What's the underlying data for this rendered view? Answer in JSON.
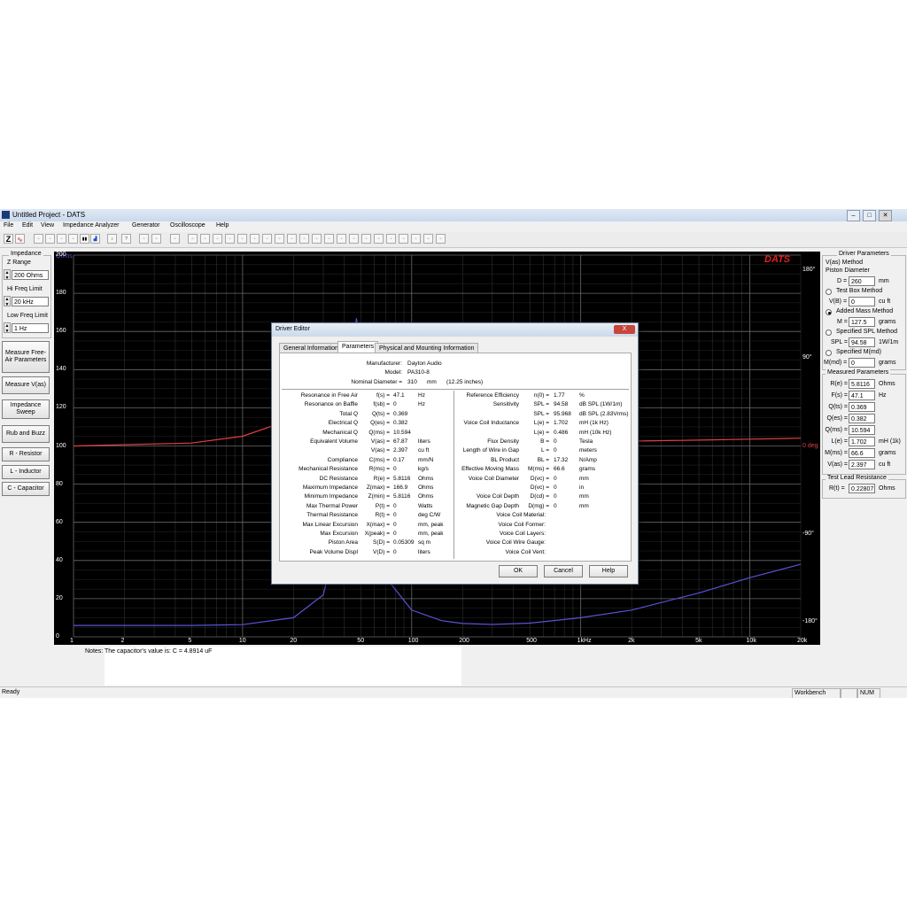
{
  "window": {
    "title": "Untitled Project - DATS"
  },
  "menu": [
    "File",
    "Edit",
    "View",
    "Impedance Analyzer",
    "Generator",
    "Oscilloscope",
    "Help"
  ],
  "left_panel": {
    "impedance_label": "Impedance",
    "z_range_label": "Z Range",
    "z_range_value": "200 Ohms",
    "hi_freq_label": "Hi Freq Limit",
    "hi_freq_value": "20 kHz",
    "low_freq_label": "Low Freq Limit",
    "low_freq_value": "1 Hz",
    "buttons": [
      "Measure Free-Air Parameters",
      "Measure V(as)",
      "Impedance Sweep",
      "Rub and Buzz",
      "R - Resistor",
      "L - Inductor",
      "C - Capacitor"
    ]
  },
  "plot": {
    "brand": "DATS",
    "y_unit": "Ohms",
    "y_ticks": [
      "200",
      "180",
      "160",
      "140",
      "120",
      "100",
      "80",
      "60",
      "40",
      "20",
      "0"
    ],
    "phase_ticks": [
      "180°",
      "90°",
      "0 deg",
      "-90°",
      "-180°"
    ],
    "x_ticks": [
      "1",
      "2",
      "5",
      "10",
      "20",
      "50",
      "100",
      "200",
      "500",
      "1kHz",
      "2k",
      "5k",
      "10k",
      "20k"
    ]
  },
  "chart_data": {
    "type": "line",
    "x_scale": "log",
    "xlim": [
      1,
      20000
    ],
    "ylim": [
      0,
      200
    ],
    "grid": true,
    "series": [
      {
        "axis": "impedance",
        "color": "#5a52d8",
        "points": [
          [
            1,
            6.0
          ],
          [
            5,
            6.0
          ],
          [
            10,
            6.4
          ],
          [
            20,
            10
          ],
          [
            30,
            22
          ],
          [
            38,
            60
          ],
          [
            42,
            110
          ],
          [
            45,
            150
          ],
          [
            47.1,
            166.9
          ],
          [
            50,
            150
          ],
          [
            55,
            95
          ],
          [
            62,
            55
          ],
          [
            75,
            28
          ],
          [
            100,
            14
          ],
          [
            150,
            8.5
          ],
          [
            200,
            7.0
          ],
          [
            300,
            6.5
          ],
          [
            500,
            7.2
          ],
          [
            1000,
            10
          ],
          [
            2000,
            14
          ],
          [
            5000,
            23
          ],
          [
            10000,
            31
          ],
          [
            20000,
            38
          ]
        ]
      },
      {
        "axis": "phase",
        "color": "#e04040",
        "points": [
          [
            1,
            0
          ],
          [
            5,
            3
          ],
          [
            10,
            10
          ],
          [
            20,
            28
          ],
          [
            30,
            45
          ],
          [
            40,
            55
          ],
          [
            44,
            45
          ],
          [
            47,
            0
          ],
          [
            50,
            -40
          ],
          [
            60,
            -35
          ],
          [
            100,
            -20
          ],
          [
            200,
            -8
          ],
          [
            500,
            -3
          ],
          [
            1000,
            2
          ],
          [
            2000,
            5
          ],
          [
            5000,
            6
          ],
          [
            10000,
            7
          ],
          [
            20000,
            8
          ]
        ]
      }
    ]
  },
  "right_panel": {
    "driver_params_title": "Driver Parameters",
    "vas_method": "V(as) Method",
    "piston_diameter": "Piston Diameter",
    "d_label": "D =",
    "d_value": "260",
    "d_unit": "mm",
    "test_box": "Test Box Method",
    "vb_label": "V(B) =",
    "vb_value": "0",
    "vb_unit": "cu ft",
    "added_mass": "Added Mass Method",
    "m_label": "M =",
    "m_value": "127.5",
    "m_unit": "grams",
    "specified_spl": "Specified SPL Method",
    "spl_label": "SPL =",
    "spl_value": "94.58",
    "spl_unit": "1W/1m",
    "specified_mmd": "Specified M(md)",
    "mmd_label": "M(md) =",
    "mmd_value": "0",
    "mmd_unit": "grams",
    "measured_title": "Measured Parameters",
    "measured": [
      {
        "label": "R(e) =",
        "value": "5.8116",
        "unit": "Ohms"
      },
      {
        "label": "F(s) =",
        "value": "47.1",
        "unit": "Hz"
      },
      {
        "label": "Q(ts) =",
        "value": "0.369",
        "unit": ""
      },
      {
        "label": "Q(es) =",
        "value": "0.382",
        "unit": ""
      },
      {
        "label": "Q(ms) =",
        "value": "10.594",
        "unit": ""
      },
      {
        "label": "L(e) =",
        "value": "1.702",
        "unit": "mH (1k)"
      },
      {
        "label": "M(ms) =",
        "value": "66.6",
        "unit": "grams"
      },
      {
        "label": "V(as) =",
        "value": "2.397",
        "unit": "cu ft"
      }
    ],
    "test_lead_title": "Test Lead Resistance",
    "rt_label": "R(t) =",
    "rt_value": "0.22807",
    "rt_unit": "Ohms"
  },
  "notes": {
    "label": "Notes:",
    "text": "The capacitor's value is:  C = 4.8914 uF"
  },
  "status": {
    "ready": "Ready",
    "workbench": "Workbench",
    "num": "NUM"
  },
  "dialog": {
    "title": "Driver Editor",
    "close": "X",
    "tabs": [
      "General Information",
      "Parameters",
      "Physical and Mounting Information"
    ],
    "manufacturer_label": "Manufacturer:",
    "manufacturer": "Dayton Audio",
    "model_label": "Model:",
    "model": "PA310-8",
    "nominal_label": "Nominal Diameter =",
    "nominal_value": "310",
    "nominal_unit": "mm",
    "nominal_inches": "(12.25  inches)",
    "left_rows": [
      {
        "name": "Resonance in Free Air",
        "sym": "f(s) =",
        "val": "47.1",
        "unit": "Hz"
      },
      {
        "name": "Resonance on Baffle",
        "sym": "f(sb) =",
        "val": "0",
        "unit": "Hz"
      },
      {
        "name": "Total Q",
        "sym": "Q(ts) =",
        "val": "0.369",
        "unit": ""
      },
      {
        "name": "Electrical Q",
        "sym": "Q(es) =",
        "val": "0.382",
        "unit": ""
      },
      {
        "name": "Mechanical Q",
        "sym": "Q(ms) =",
        "val": "10.594",
        "unit": ""
      },
      {
        "name": "Equivalent Volume",
        "sym": "V(as) =",
        "val": "67.87",
        "unit": "liters"
      },
      {
        "name": "",
        "sym": "V(as) =",
        "val": "2.397",
        "unit": "cu ft"
      },
      {
        "name": "Compliance",
        "sym": "C(ms) =",
        "val": "0.17",
        "unit": "mm/N"
      },
      {
        "name": "Mechanical Resistance",
        "sym": "R(ms) =",
        "val": "0",
        "unit": "kg/s"
      },
      {
        "name": "DC Resistance",
        "sym": "R(e) =",
        "val": "5.8116",
        "unit": "Ohms"
      },
      {
        "name": "Maximum Impedance",
        "sym": "Z(max) =",
        "val": "166.9",
        "unit": "Ohms"
      },
      {
        "name": "Minimum Impedance",
        "sym": "Z(min) =",
        "val": "5.8116",
        "unit": "Ohms"
      },
      {
        "name": "Max Thermal Power",
        "sym": "P(t) =",
        "val": "0",
        "unit": "Watts"
      },
      {
        "name": "Thermal Resistance",
        "sym": "R(t) =",
        "val": "0",
        "unit": "deg C/W"
      },
      {
        "name": "Max Linear Excursion",
        "sym": "X(max) =",
        "val": "0",
        "unit": "mm, peak"
      },
      {
        "name": "Max Excursion",
        "sym": "X(peak) =",
        "val": "0",
        "unit": "mm, peak"
      },
      {
        "name": "Piston Area",
        "sym": "S(D) =",
        "val": "0.05309",
        "unit": "sq m"
      },
      {
        "name": "Peak Volume Displ",
        "sym": "V(D) =",
        "val": "0",
        "unit": "liters"
      }
    ],
    "right_rows": [
      {
        "name": "Reference Efficiency",
        "sym": "n(0) =",
        "val": "1.77",
        "unit": "%"
      },
      {
        "name": "Sensitivity",
        "sym": "SPL =",
        "val": "94.58",
        "unit": "dB SPL (1W/1m)"
      },
      {
        "name": "",
        "sym": "SPL =",
        "val": "95.968",
        "unit": "dB SPL (2.83Vrms)"
      },
      {
        "name": "Voice Coil Inductance",
        "sym": "L(e) =",
        "val": "1.702",
        "unit": "mH (1k Hz)"
      },
      {
        "name": "",
        "sym": "L(e) =",
        "val": "0.486",
        "unit": "mH (10k Hz)"
      },
      {
        "name": "Flux Density",
        "sym": "B =",
        "val": "0",
        "unit": "Tesla"
      },
      {
        "name": "Length of Wire in Gap",
        "sym": "L =",
        "val": "0",
        "unit": "meters"
      },
      {
        "name": "BL Product",
        "sym": "BL =",
        "val": "17.32",
        "unit": "N/Amp"
      },
      {
        "name": "Effective Moving Mass",
        "sym": "M(ms) =",
        "val": "66.6",
        "unit": "grams"
      },
      {
        "name": "Voice Coil Diameter",
        "sym": "D(vc) =",
        "val": "0",
        "unit": "mm"
      },
      {
        "name": "",
        "sym": "D(vc) =",
        "val": "0",
        "unit": "in"
      },
      {
        "name": "Voice Coil Depth",
        "sym": "D(cd) =",
        "val": "0",
        "unit": "mm"
      },
      {
        "name": "Magnetic Gap Depth",
        "sym": "D(mg) =",
        "val": "0",
        "unit": "mm"
      },
      {
        "name": "Voice Coil Material:",
        "sym": "",
        "val": "",
        "unit": ""
      },
      {
        "name": "Voice Coil Former:",
        "sym": "",
        "val": "",
        "unit": ""
      },
      {
        "name": "Voice Coil Layers:",
        "sym": "",
        "val": "",
        "unit": ""
      },
      {
        "name": "Voice Coil Wire Gauge:",
        "sym": "",
        "val": "",
        "unit": ""
      },
      {
        "name": "Voice Coil Vent:",
        "sym": "",
        "val": "",
        "unit": ""
      }
    ],
    "ok": "OK",
    "cancel": "Cancel",
    "help": "Help"
  }
}
